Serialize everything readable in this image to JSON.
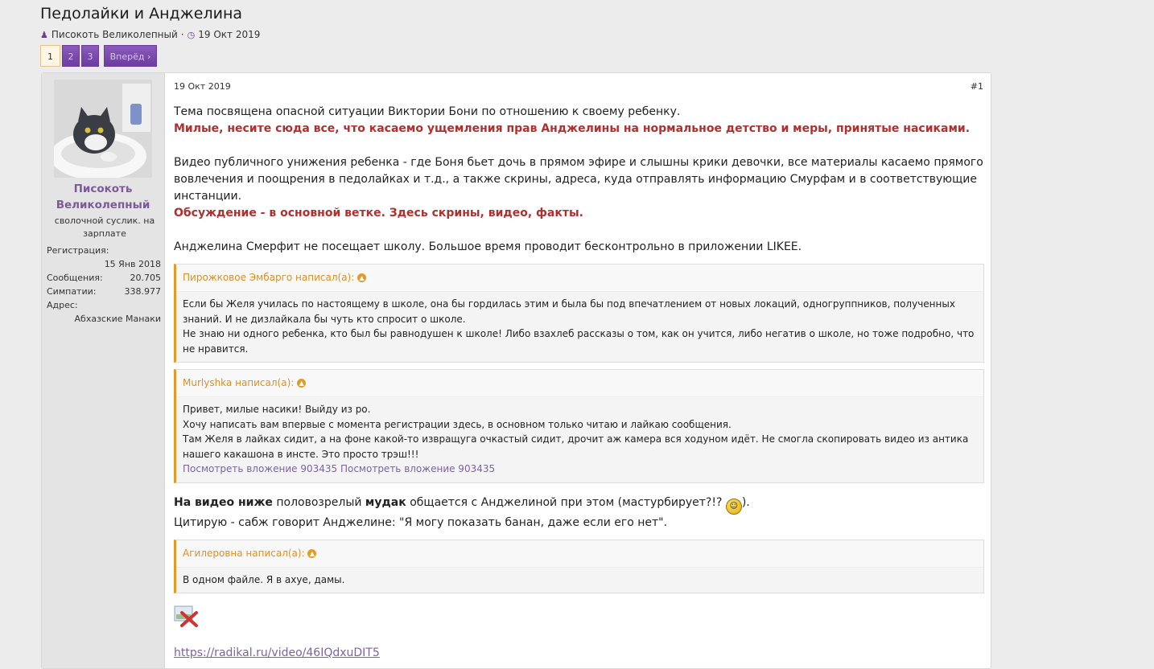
{
  "thread": {
    "title": "Педолайки и Анджелина",
    "author": "Писокоть Великолепный",
    "date": "19 Окт 2019",
    "pages": [
      "1",
      "2",
      "3"
    ],
    "next_label": "Вперёд ›"
  },
  "user": {
    "name_line1": "Писокоть",
    "name_line2": "Великолепный",
    "title": "сволочной суслик. на зарплате",
    "reg_label": "Регистрация:",
    "reg_value": "15 Янв 2018",
    "msgs_label": "Сообщения:",
    "msgs_value": "20.705",
    "likes_label": "Симпатии:",
    "likes_value": "338.977",
    "addr_label": "Адрес:",
    "addr_value": "Абхазские Манаки"
  },
  "post": {
    "date": "19 Окт 2019",
    "number": "#1",
    "p1": "Тема посвящена опасной ситуации Виктории Бони по отношению к своему ребенку.",
    "p1_red": "Милые, несите сюда все, что касаемо ущемления прав Анджелины на нормальное детство и меры, принятые насиками.",
    "p2": "Видео публичного унижения ребенка - где Боня бьет дочь в прямом эфире и слышны крики девочки, все материалы касаемо прямого вовлечения и поощрения в педолайках и т.д., а также скрины, адреса, куда отправлять информацию Смурфам и в соответствующие инстанции.",
    "p2_red": "Обсуждение - в основной ветке. Здесь скрины, видео, факты.",
    "p3": "Анджелина Смерфит не посещает школу. Большое время проводит бесконтрольно в приложении LIKEE.",
    "quote1_head": "Пирожковое Эмбарго написал(а):",
    "quote1_l1": "Если бы Желя училась по настоящему в школе, она бы гордилась этим и была бы под впечатлением от новых локаций, одногруппников, полученных знаний. И не дизлайкала бы чуть кто спросит о школе.",
    "quote1_l2": "Не знаю ни одного ребенка, кто был бы равнодушен к школе! Либо взахлеб рассказы о том, как он учится, либо негатив о школе, но тоже подробно, что не нравится.",
    "quote2_head": "Murlyshka написал(а):",
    "quote2_l1": "Привет, милые насики! Выйду из ро.",
    "quote2_l2": "Хочу написать вам впервые с момента регистрации здесь, в основном только читаю и лайкаю сообщения.",
    "quote2_l3": "Там Желя в лайках сидит, а на фоне какой-то извращуга очкастый сидит, дрочит аж камера вся ходуном идёт. Не смогла скопировать видео из антика нашего какашона в инсте. Это просто трэш!!!",
    "quote2_att": "Посмотреть вложение 903435 Посмотреть вложение 903435",
    "p4_b1": "На видео ниже",
    "p4_t1": " половозрелый ",
    "p4_b2": "мудак",
    "p4_t2": " общается с Анджелиной при этом (мастурбирует?!? ",
    "p4_t3": ").",
    "p5": "Цитирую - сабж говорит Анджелине: \"Я могу показать банан, даже если его нет\".",
    "quote3_head": "Агилеровна написал(а):",
    "quote3_l1": "В одном файле. Я в ахуе, дамы.",
    "link": "https://radikal.ru/video/46IQdxuDIT5"
  }
}
